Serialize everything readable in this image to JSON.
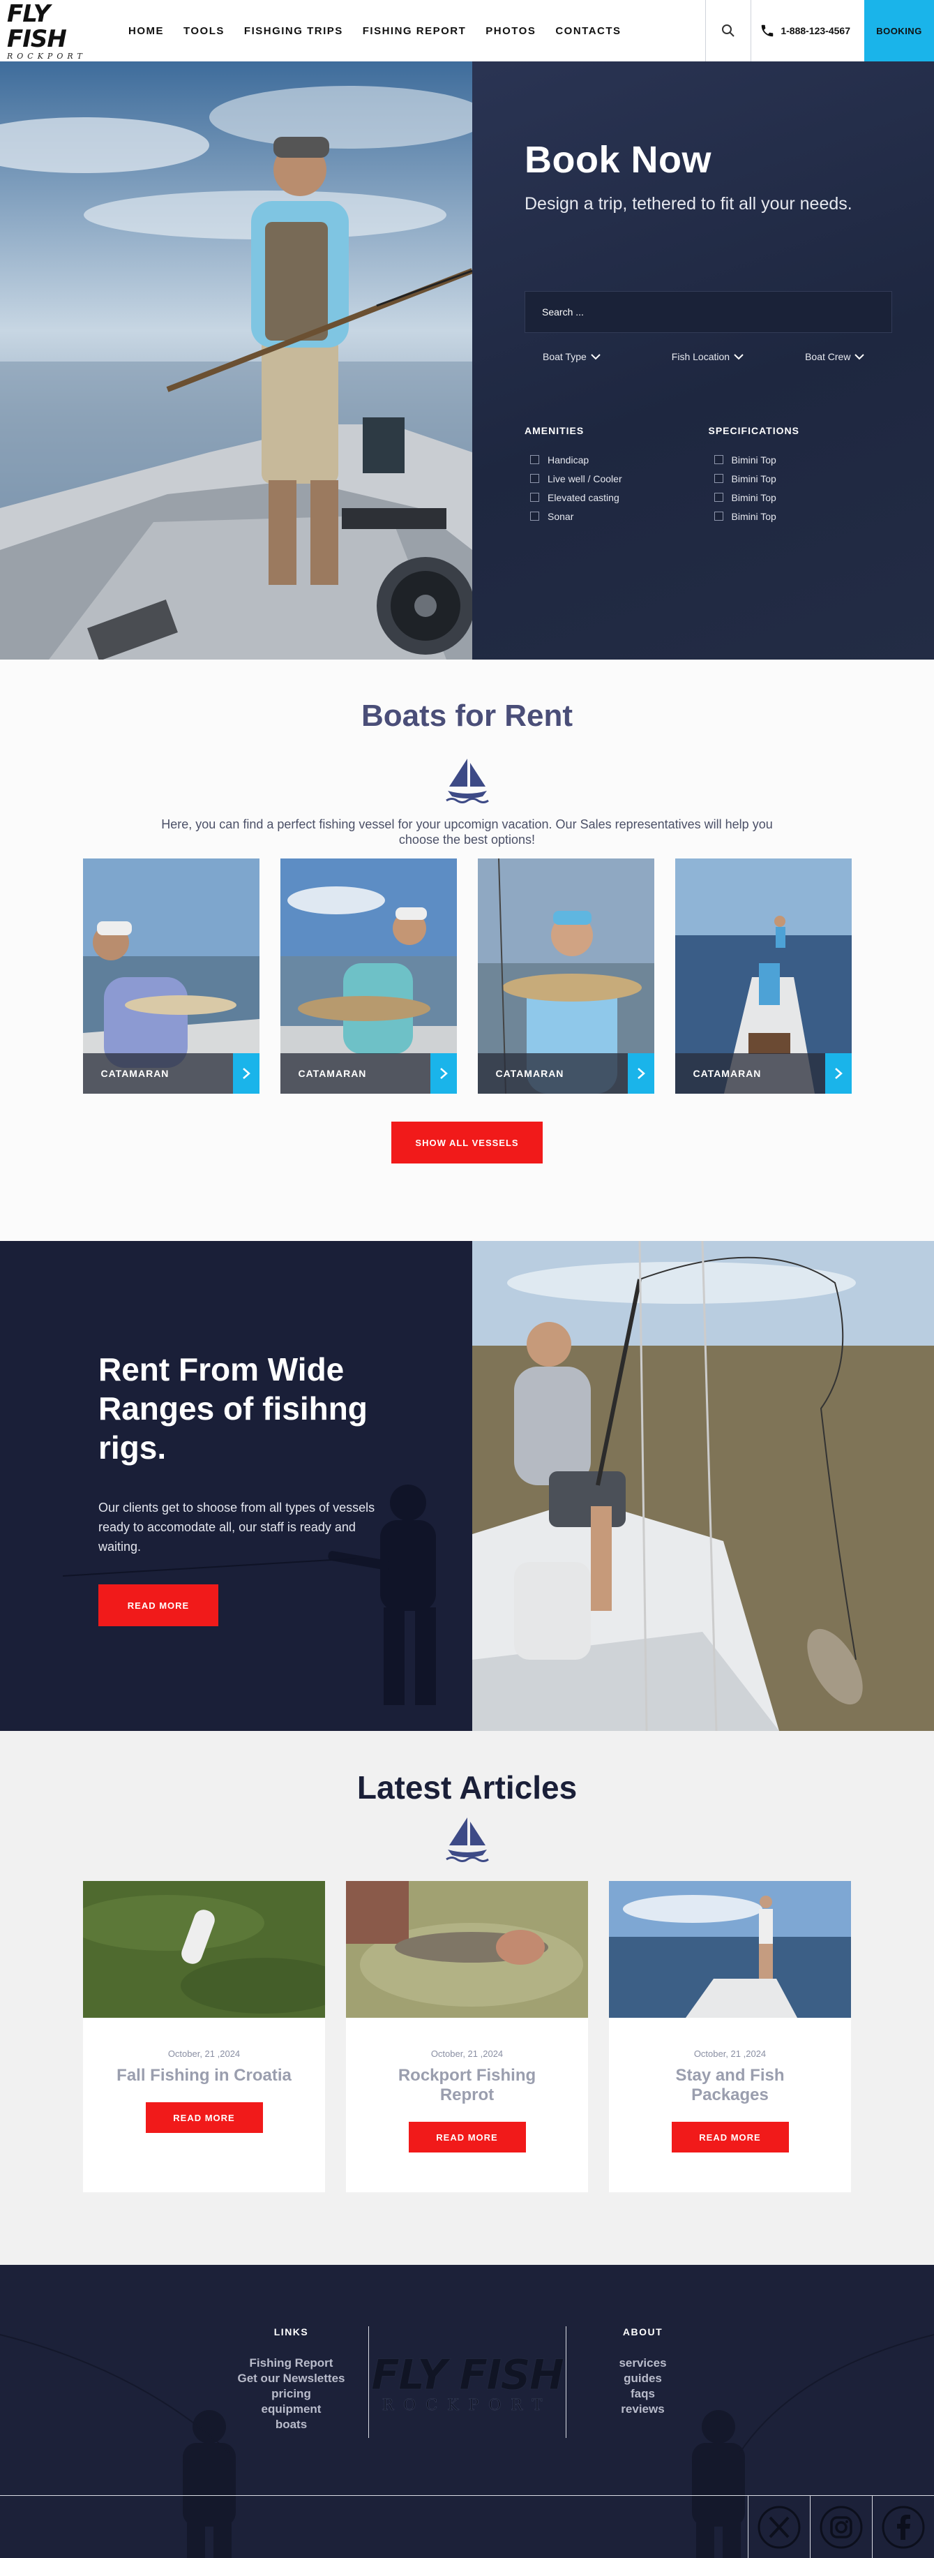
{
  "nav": {
    "logo_main": "FLY FISH",
    "logo_sub": "ROCKPORT",
    "menu": [
      "HOME",
      "TOOLS",
      "FISHGING TRIPS",
      "FISHING REPORT",
      "PHOTOS",
      "CONTACTS"
    ],
    "phone": "1-888-123-4567",
    "booking": "BOOKING"
  },
  "hero": {
    "title": "Book Now",
    "subtitle": "Design a trip, tethered to fit all your needs.",
    "search_placeholder": "Search ...",
    "filters": [
      "Boat Type",
      "Fish Location",
      "Boat Crew"
    ],
    "amenities_head": "AMENITIES",
    "amenities": [
      "Handicap",
      "Live well / Cooler",
      "Elevated casting",
      "Sonar"
    ],
    "specs_head": "SPECIFICATIONS",
    "specs": [
      "Bimini Top",
      "Bimini Top",
      "Bimini Top",
      "Bimini Top"
    ]
  },
  "boats": {
    "title": "Boats for Rent",
    "intro": "Here, you can find a perfect fishing vessel for your upcomign vacation.  Our Sales representatives will help you choose the best options!",
    "cards": [
      {
        "label": "CATAMARAN"
      },
      {
        "label": "CATAMARAN"
      },
      {
        "label": "CATAMARAN"
      },
      {
        "label": "CATAMARAN"
      }
    ],
    "show_all": "SHOW ALL VESSELS"
  },
  "rent": {
    "title": "Rent From Wide Ranges of fisihng rigs.",
    "text": "Our clients get to shoose from all types of vessels ready to accomodate all, our staff is ready and waiting.",
    "button": "READ MORE"
  },
  "articles": {
    "title": "Latest Articles",
    "items": [
      {
        "date": "October, 21 ,2024",
        "title": "Fall Fishing in Croatia",
        "button": "READ MORE"
      },
      {
        "date": "October, 21 ,2024",
        "title": "Rockport Fishing Reprot",
        "button": "READ MORE"
      },
      {
        "date": "October, 21 ,2024",
        "title": "Stay and Fish Packages",
        "button": "READ MORE"
      }
    ]
  },
  "footer": {
    "links_head": "LINKS",
    "links": [
      "Fishing Report",
      "Get our Newslettes",
      "pricing",
      "equipment",
      "boats"
    ],
    "about_head": "ABOUT",
    "about": [
      "services",
      "guides",
      "faqs",
      "reviews"
    ],
    "logo_main": "FLY FISH",
    "logo_sub": "ROCKPORT",
    "socials": [
      "x-icon",
      "instagram-icon",
      "facebook-icon"
    ]
  },
  "colors": {
    "navy": "#1a1f38",
    "accent_blue": "#1ab4ea",
    "cta_red": "#f11a1a",
    "heading_purple": "#4a4e78"
  }
}
